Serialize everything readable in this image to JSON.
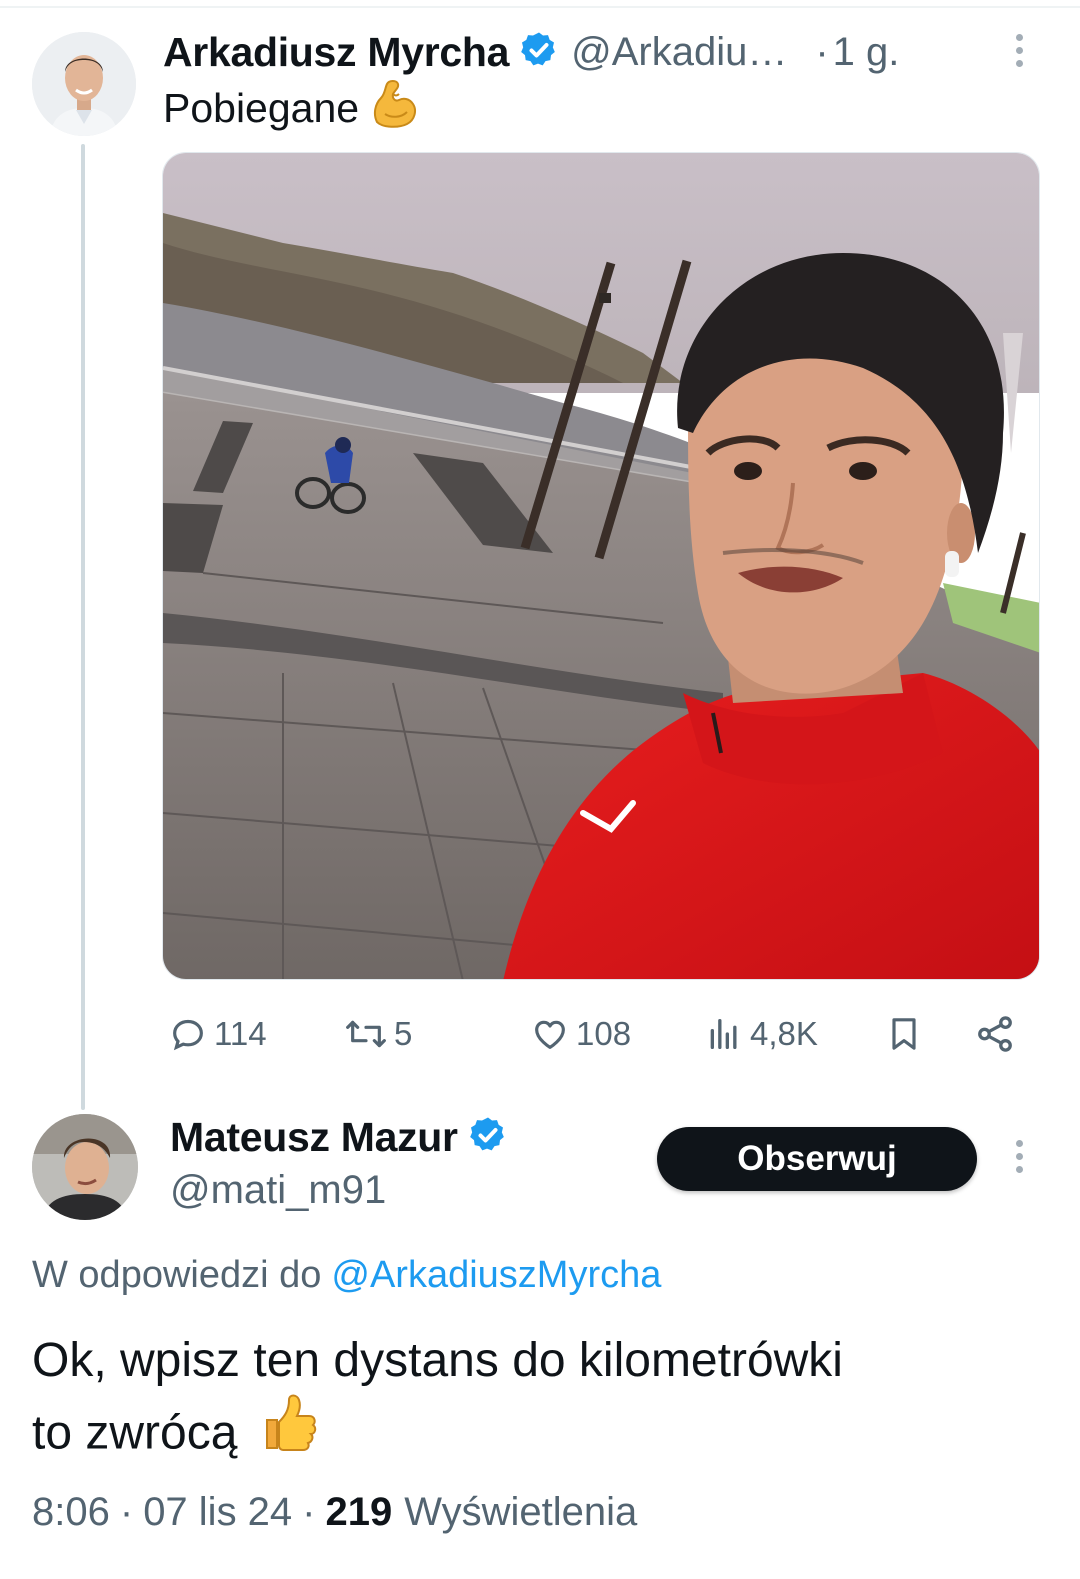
{
  "parent_tweet": {
    "author_name": "Arkadiusz Myrcha",
    "handle": "@Arkadiu…",
    "time_separator": "·",
    "time": "1 g.",
    "text": "Pobiegane",
    "text_emoji": "flexed-biceps-icon",
    "image": "selfie-runner-riverside-photo",
    "stats": {
      "replies": "114",
      "retweets": "5",
      "likes": "108",
      "views": "4,8K"
    }
  },
  "reply_tweet": {
    "author_name": "Mateusz Mazur",
    "handle": "@mati_m91",
    "follow_label": "Obserwuj",
    "reply_to_prefix": "W odpowiedzi do",
    "reply_to_handle": "@ArkadiuszMyrcha",
    "text_line1": "Ok, wpisz ten dystans do kilometrówki",
    "text_line2": "to zwrócą",
    "text_emoji": "thumbs-up-icon",
    "time": "8:06",
    "date": "07 lis 24",
    "separator": "·",
    "views_count": "219",
    "views_label": "Wyświetlenia"
  },
  "colors": {
    "text_primary": "#0f1419",
    "text_secondary": "#536471",
    "accent": "#1d9bf0",
    "thread_line": "#cfd9de",
    "button_dark": "#0f1419"
  }
}
